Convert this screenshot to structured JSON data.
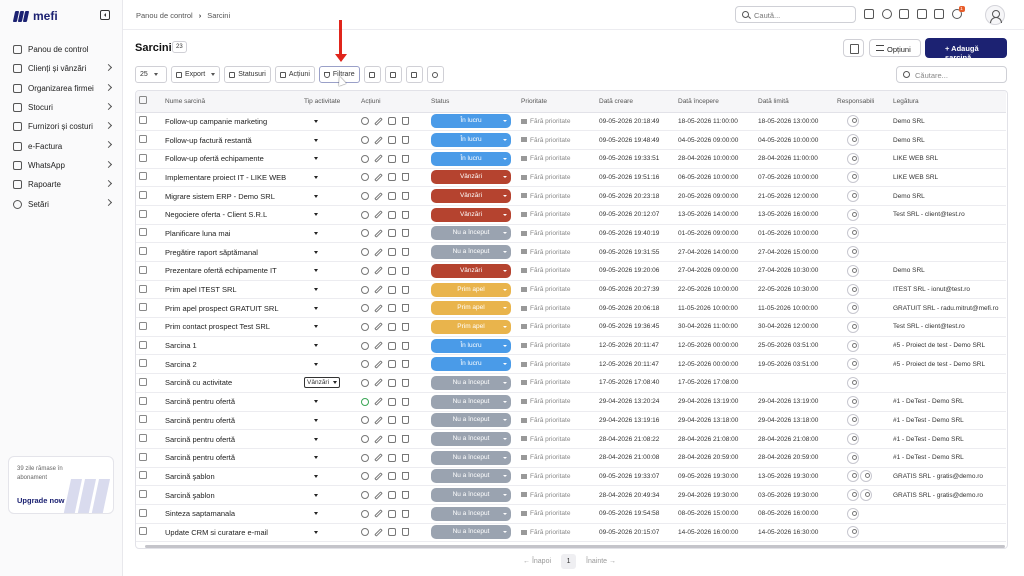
{
  "app": {
    "logo_text": "mefi"
  },
  "sidebar": {
    "items": [
      {
        "label": "Panou de control",
        "icon": "home-icon",
        "chevron": false
      },
      {
        "label": "Clienți și vânzări",
        "icon": "users-icon",
        "chevron": true
      },
      {
        "label": "Organizarea firmei",
        "icon": "building-icon",
        "chevron": true
      },
      {
        "label": "Stocuri",
        "icon": "box-icon",
        "chevron": true
      },
      {
        "label": "Furnizori și costuri",
        "icon": "wallet-icon",
        "chevron": true
      },
      {
        "label": "e-Factura",
        "icon": "invoice-icon",
        "chevron": true
      },
      {
        "label": "WhatsApp",
        "icon": "whatsapp-icon",
        "chevron": true
      },
      {
        "label": "Rapoarte",
        "icon": "report-icon",
        "chevron": true
      },
      {
        "label": "Setări",
        "icon": "gear-icon",
        "chevron": true
      }
    ],
    "upgrade": {
      "text": "39 zile rămase în abonament",
      "button": "Upgrade now"
    }
  },
  "topbar": {
    "breadcrumb": [
      "Panou de control",
      "Sarcini"
    ],
    "search_placeholder": "Caută...",
    "notification_count": "1"
  },
  "header": {
    "title": "Sarcini",
    "count": "23",
    "options_label": "Opțiuni",
    "add_label": "+ Adaugă sarcină"
  },
  "toolbar": {
    "page_size": "25",
    "export_label": "Export",
    "status_label": "Statusuri",
    "actions_label": "Acțiuni",
    "filter_label": "Filtrare",
    "search_placeholder": "Căutare..."
  },
  "table": {
    "headers": [
      "Nume sarcină",
      "Tip activitate",
      "Acțiuni",
      "Status",
      "Prioritate",
      "Dată creare",
      "Dată începere",
      "Dată limită",
      "Responsabili",
      "Legătura"
    ],
    "priority_text": "Fără prioritate",
    "rows": [
      {
        "name": "Follow-up campanie marketing",
        "tip": "",
        "status": "În lucru",
        "status_color": "#4a9be8",
        "created": "09-05-2026 20:18:49",
        "start": "18-05-2026 11:00:00",
        "due": "18-05-2026 13:00:00",
        "resp": 1,
        "link": "Demo SRL",
        "play": false
      },
      {
        "name": "Follow-up factură restantă",
        "tip": "",
        "status": "În lucru",
        "status_color": "#4a9be8",
        "created": "09-05-2026 19:48:49",
        "start": "04-05-2026 09:00:00",
        "due": "04-05-2026 10:00:00",
        "resp": 1,
        "link": "Demo SRL",
        "play": false
      },
      {
        "name": "Follow-up ofertă echipamente",
        "tip": "",
        "status": "În lucru",
        "status_color": "#4a9be8",
        "created": "09-05-2026 19:33:51",
        "start": "28-04-2026 10:00:00",
        "due": "28-04-2026 11:00:00",
        "resp": 1,
        "link": "LIKE WEB SRL",
        "play": false
      },
      {
        "name": "Implementare proiect IT - LIKE WEB",
        "tip": "",
        "status": "Vânzări",
        "status_color": "#b5432f",
        "created": "09-05-2026 19:51:16",
        "start": "06-05-2026 10:00:00",
        "due": "07-05-2026 10:00:00",
        "resp": 1,
        "link": "LIKE WEB SRL",
        "play": false
      },
      {
        "name": "Migrare sistem ERP - Demo SRL",
        "tip": "",
        "status": "Vânzări",
        "status_color": "#b5432f",
        "created": "09-05-2026 20:23:18",
        "start": "20-05-2026 09:00:00",
        "due": "21-05-2026 12:00:00",
        "resp": 1,
        "link": "Demo SRL",
        "play": false
      },
      {
        "name": "Negociere oferta - Client S.R.L",
        "tip": "",
        "status": "Vânzări",
        "status_color": "#b5432f",
        "created": "09-05-2026 20:12:07",
        "start": "13-05-2026 14:00:00",
        "due": "13-05-2026 16:00:00",
        "resp": 1,
        "link": "Test SRL - client@test.ro",
        "play": false
      },
      {
        "name": "Planificare luna mai",
        "tip": "",
        "status": "Nu a început",
        "status_color": "#9aa3b0",
        "created": "09-05-2026 19:40:19",
        "start": "01-05-2026 09:00:00",
        "due": "01-05-2026 10:00:00",
        "resp": 1,
        "link": "",
        "play": false
      },
      {
        "name": "Pregătire raport săptămanal",
        "tip": "",
        "status": "Nu a început",
        "status_color": "#9aa3b0",
        "created": "09-05-2026 19:31:55",
        "start": "27-04-2026 14:00:00",
        "due": "27-04-2026 15:00:00",
        "resp": 1,
        "link": "",
        "play": false
      },
      {
        "name": "Prezentare ofertă echipamente IT",
        "tip": "",
        "status": "Vânzări",
        "status_color": "#b5432f",
        "created": "09-05-2026 19:20:06",
        "start": "27-04-2026 09:00:00",
        "due": "27-04-2026 10:30:00",
        "resp": 1,
        "link": "Demo SRL",
        "play": false
      },
      {
        "name": "Prim apel ITEST SRL",
        "tip": "",
        "status": "Prim apel",
        "status_color": "#e9b44c",
        "created": "09-05-2026 20:27:39",
        "start": "22-05-2026 10:00:00",
        "due": "22-05-2026 10:30:00",
        "resp": 1,
        "link": "ITEST SRL - ionut@test.ro",
        "play": false
      },
      {
        "name": "Prim apel prospect GRATUIT SRL",
        "tip": "",
        "status": "Prim apel",
        "status_color": "#e9b44c",
        "created": "09-05-2026 20:06:18",
        "start": "11-05-2026 10:00:00",
        "due": "11-05-2026 10:00:00",
        "resp": 1,
        "link": "GRATUIT SRL - radu.mitrut@mefi.ro",
        "play": false
      },
      {
        "name": "Prim contact prospect Test SRL",
        "tip": "",
        "status": "Prim apel",
        "status_color": "#e9b44c",
        "created": "09-05-2026 19:36:45",
        "start": "30-04-2026 11:00:00",
        "due": "30-04-2026 12:00:00",
        "resp": 1,
        "link": "Test SRL - client@test.ro",
        "play": false
      },
      {
        "name": "Sarcina 1",
        "tip": "",
        "status": "În lucru",
        "status_color": "#4a9be8",
        "created": "12-05-2026 20:11:47",
        "start": "12-05-2026 00:00:00",
        "due": "25-05-2026 03:51:00",
        "resp": 1,
        "link": "#5 - Proiect de test - Demo SRL",
        "play": false
      },
      {
        "name": "Sarcina 2",
        "tip": "",
        "status": "În lucru",
        "status_color": "#4a9be8",
        "created": "12-05-2026 20:11:47",
        "start": "12-05-2026 00:00:00",
        "due": "19-05-2026 03:51:00",
        "resp": 1,
        "link": "#5 - Proiect de test - Demo SRL",
        "play": false
      },
      {
        "name": "Sarcină cu activitate",
        "tip": "Vânzări",
        "status": "Nu a început",
        "status_color": "#9aa3b0",
        "created": "17-05-2026 17:08:40",
        "start": "17-05-2026 17:08:00",
        "due": "",
        "resp": 1,
        "link": "",
        "play": false
      },
      {
        "name": "Sarcină pentru ofertă",
        "tip": "",
        "status": "Nu a început",
        "status_color": "#9aa3b0",
        "created": "29-04-2026 13:20:24",
        "start": "29-04-2026 13:19:00",
        "due": "29-04-2026 13:19:00",
        "resp": 1,
        "link": "#1 - DeTest - Demo SRL",
        "play": true
      },
      {
        "name": "Sarcină pentru ofertă",
        "tip": "",
        "status": "Nu a început",
        "status_color": "#9aa3b0",
        "created": "29-04-2026 13:19:16",
        "start": "29-04-2026 13:18:00",
        "due": "29-04-2026 13:18:00",
        "resp": 1,
        "link": "#1 - DeTest - Demo SRL",
        "play": false
      },
      {
        "name": "Sarcină pentru ofertă",
        "tip": "",
        "status": "Nu a început",
        "status_color": "#9aa3b0",
        "created": "28-04-2026 21:08:22",
        "start": "28-04-2026 21:08:00",
        "due": "28-04-2026 21:08:00",
        "resp": 1,
        "link": "#1 - DeTest - Demo SRL",
        "play": false
      },
      {
        "name": "Sarcină pentru ofertă",
        "tip": "",
        "status": "Nu a început",
        "status_color": "#9aa3b0",
        "created": "28-04-2026 21:00:08",
        "start": "28-04-2026 20:59:00",
        "due": "28-04-2026 20:59:00",
        "resp": 1,
        "link": "#1 - DeTest - Demo SRL",
        "play": false
      },
      {
        "name": "Sarcină şablon",
        "tip": "",
        "status": "Nu a început",
        "status_color": "#9aa3b0",
        "created": "09-05-2026 19:33:07",
        "start": "09-05-2026 19:30:00",
        "due": "13-05-2026 19:30:00",
        "resp": 2,
        "link": "GRATIS SRL - gratis@demo.ro",
        "play": false
      },
      {
        "name": "Sarcină şablon",
        "tip": "",
        "status": "Nu a început",
        "status_color": "#9aa3b0",
        "created": "28-04-2026 20:49:34",
        "start": "29-04-2026 19:30:00",
        "due": "03-05-2026 19:30:00",
        "resp": 2,
        "link": "GRATIS SRL - gratis@demo.ro",
        "play": false
      },
      {
        "name": "Sinteza saptamanala",
        "tip": "",
        "status": "Nu a început",
        "status_color": "#9aa3b0",
        "created": "09-05-2026 19:54:58",
        "start": "08-05-2026 15:00:00",
        "due": "08-05-2026 16:00:00",
        "resp": 1,
        "link": "",
        "play": false
      },
      {
        "name": "Update CRM si curatare e-mail",
        "tip": "",
        "status": "Nu a început",
        "status_color": "#9aa3b0",
        "created": "09-05-2026 20:15:07",
        "start": "14-05-2026 16:00:00",
        "due": "14-05-2026 16:30:00",
        "resp": 1,
        "link": "",
        "play": false
      }
    ]
  },
  "pagination": {
    "prev": "← Înapoi",
    "page": "1",
    "next": "Înainte →"
  }
}
